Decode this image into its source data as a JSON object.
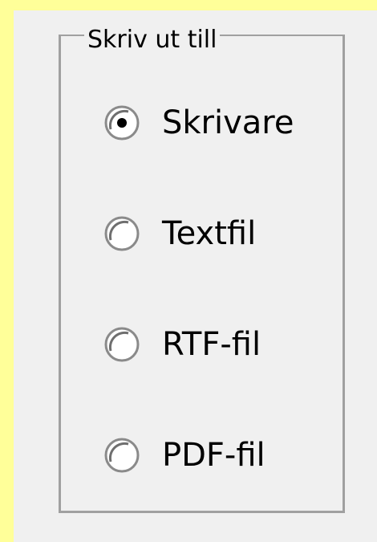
{
  "group": {
    "title": "Skriv ut till"
  },
  "options": [
    {
      "label": "Skrivare",
      "selected": true
    },
    {
      "label": "Textfil",
      "selected": false
    },
    {
      "label": "RTF-fil",
      "selected": false
    },
    {
      "label": "PDF-fil",
      "selected": false
    }
  ],
  "colors": {
    "background": "#ffff99",
    "panel": "#f0f0f0",
    "group_border": "#a0a0a0"
  }
}
